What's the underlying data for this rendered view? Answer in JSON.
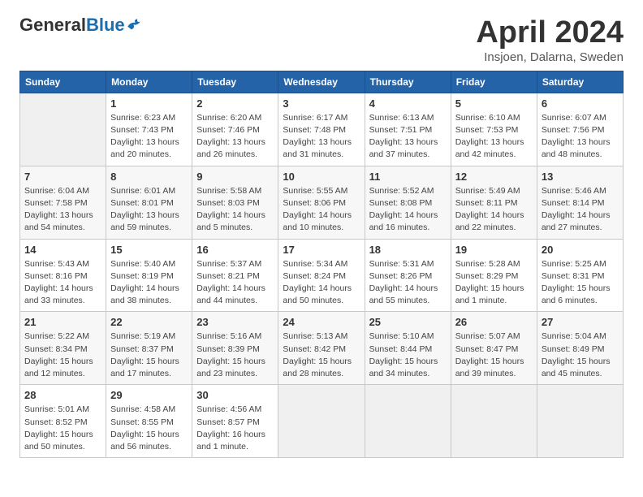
{
  "header": {
    "logo_general": "General",
    "logo_blue": "Blue",
    "title": "April 2024",
    "location": "Insjoen, Dalarna, Sweden"
  },
  "weekdays": [
    "Sunday",
    "Monday",
    "Tuesday",
    "Wednesday",
    "Thursday",
    "Friday",
    "Saturday"
  ],
  "weeks": [
    [
      {
        "day": "",
        "info": ""
      },
      {
        "day": "1",
        "info": "Sunrise: 6:23 AM\nSunset: 7:43 PM\nDaylight: 13 hours\nand 20 minutes."
      },
      {
        "day": "2",
        "info": "Sunrise: 6:20 AM\nSunset: 7:46 PM\nDaylight: 13 hours\nand 26 minutes."
      },
      {
        "day": "3",
        "info": "Sunrise: 6:17 AM\nSunset: 7:48 PM\nDaylight: 13 hours\nand 31 minutes."
      },
      {
        "day": "4",
        "info": "Sunrise: 6:13 AM\nSunset: 7:51 PM\nDaylight: 13 hours\nand 37 minutes."
      },
      {
        "day": "5",
        "info": "Sunrise: 6:10 AM\nSunset: 7:53 PM\nDaylight: 13 hours\nand 42 minutes."
      },
      {
        "day": "6",
        "info": "Sunrise: 6:07 AM\nSunset: 7:56 PM\nDaylight: 13 hours\nand 48 minutes."
      }
    ],
    [
      {
        "day": "7",
        "info": "Sunrise: 6:04 AM\nSunset: 7:58 PM\nDaylight: 13 hours\nand 54 minutes."
      },
      {
        "day": "8",
        "info": "Sunrise: 6:01 AM\nSunset: 8:01 PM\nDaylight: 13 hours\nand 59 minutes."
      },
      {
        "day": "9",
        "info": "Sunrise: 5:58 AM\nSunset: 8:03 PM\nDaylight: 14 hours\nand 5 minutes."
      },
      {
        "day": "10",
        "info": "Sunrise: 5:55 AM\nSunset: 8:06 PM\nDaylight: 14 hours\nand 10 minutes."
      },
      {
        "day": "11",
        "info": "Sunrise: 5:52 AM\nSunset: 8:08 PM\nDaylight: 14 hours\nand 16 minutes."
      },
      {
        "day": "12",
        "info": "Sunrise: 5:49 AM\nSunset: 8:11 PM\nDaylight: 14 hours\nand 22 minutes."
      },
      {
        "day": "13",
        "info": "Sunrise: 5:46 AM\nSunset: 8:14 PM\nDaylight: 14 hours\nand 27 minutes."
      }
    ],
    [
      {
        "day": "14",
        "info": "Sunrise: 5:43 AM\nSunset: 8:16 PM\nDaylight: 14 hours\nand 33 minutes."
      },
      {
        "day": "15",
        "info": "Sunrise: 5:40 AM\nSunset: 8:19 PM\nDaylight: 14 hours\nand 38 minutes."
      },
      {
        "day": "16",
        "info": "Sunrise: 5:37 AM\nSunset: 8:21 PM\nDaylight: 14 hours\nand 44 minutes."
      },
      {
        "day": "17",
        "info": "Sunrise: 5:34 AM\nSunset: 8:24 PM\nDaylight: 14 hours\nand 50 minutes."
      },
      {
        "day": "18",
        "info": "Sunrise: 5:31 AM\nSunset: 8:26 PM\nDaylight: 14 hours\nand 55 minutes."
      },
      {
        "day": "19",
        "info": "Sunrise: 5:28 AM\nSunset: 8:29 PM\nDaylight: 15 hours\nand 1 minute."
      },
      {
        "day": "20",
        "info": "Sunrise: 5:25 AM\nSunset: 8:31 PM\nDaylight: 15 hours\nand 6 minutes."
      }
    ],
    [
      {
        "day": "21",
        "info": "Sunrise: 5:22 AM\nSunset: 8:34 PM\nDaylight: 15 hours\nand 12 minutes."
      },
      {
        "day": "22",
        "info": "Sunrise: 5:19 AM\nSunset: 8:37 PM\nDaylight: 15 hours\nand 17 minutes."
      },
      {
        "day": "23",
        "info": "Sunrise: 5:16 AM\nSunset: 8:39 PM\nDaylight: 15 hours\nand 23 minutes."
      },
      {
        "day": "24",
        "info": "Sunrise: 5:13 AM\nSunset: 8:42 PM\nDaylight: 15 hours\nand 28 minutes."
      },
      {
        "day": "25",
        "info": "Sunrise: 5:10 AM\nSunset: 8:44 PM\nDaylight: 15 hours\nand 34 minutes."
      },
      {
        "day": "26",
        "info": "Sunrise: 5:07 AM\nSunset: 8:47 PM\nDaylight: 15 hours\nand 39 minutes."
      },
      {
        "day": "27",
        "info": "Sunrise: 5:04 AM\nSunset: 8:49 PM\nDaylight: 15 hours\nand 45 minutes."
      }
    ],
    [
      {
        "day": "28",
        "info": "Sunrise: 5:01 AM\nSunset: 8:52 PM\nDaylight: 15 hours\nand 50 minutes."
      },
      {
        "day": "29",
        "info": "Sunrise: 4:58 AM\nSunset: 8:55 PM\nDaylight: 15 hours\nand 56 minutes."
      },
      {
        "day": "30",
        "info": "Sunrise: 4:56 AM\nSunset: 8:57 PM\nDaylight: 16 hours\nand 1 minute."
      },
      {
        "day": "",
        "info": ""
      },
      {
        "day": "",
        "info": ""
      },
      {
        "day": "",
        "info": ""
      },
      {
        "day": "",
        "info": ""
      }
    ]
  ]
}
